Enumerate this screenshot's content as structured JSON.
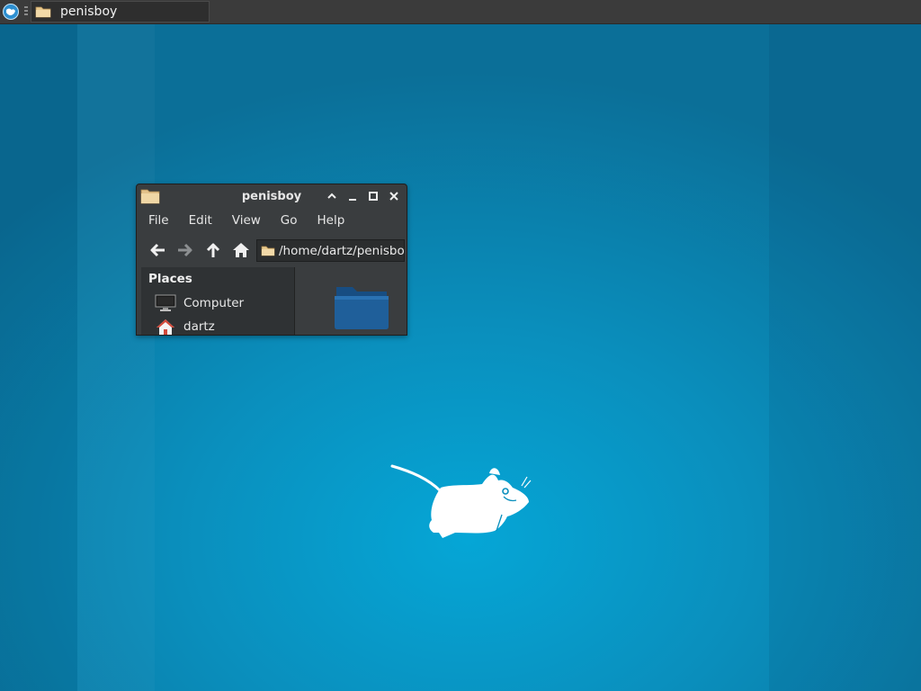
{
  "colors": {
    "desktop": "#0a8fbd",
    "panel": "#3b3b3b",
    "window_bg": "#3a3d3f",
    "folder_tan": "#e8c98d",
    "folder_blue": "#1f5f9a"
  },
  "panel": {
    "menu_icon": "xfce-menu-icon",
    "task_button": {
      "icon": "folder-icon",
      "label": "penisboy"
    }
  },
  "window": {
    "title": "penisboy",
    "title_icon": "folder-icon",
    "controls": [
      "shade-up-icon",
      "minimize-icon",
      "maximize-icon",
      "close-icon"
    ],
    "menu": [
      "File",
      "Edit",
      "View",
      "Go",
      "Help"
    ],
    "toolbar": [
      "back-arrow-icon",
      "forward-arrow-icon",
      "up-arrow-icon",
      "home-icon"
    ],
    "path": "/home/dartz/penisboy",
    "sidebar": {
      "heading": "Places",
      "items": [
        {
          "label": "Computer",
          "icon": "computer-icon"
        },
        {
          "label": "dartz",
          "icon": "home-folder-icon"
        }
      ]
    },
    "content_items": [
      {
        "icon": "folder-icon"
      }
    ]
  },
  "desktop": {
    "logo": "xfce-mouse-logo"
  }
}
